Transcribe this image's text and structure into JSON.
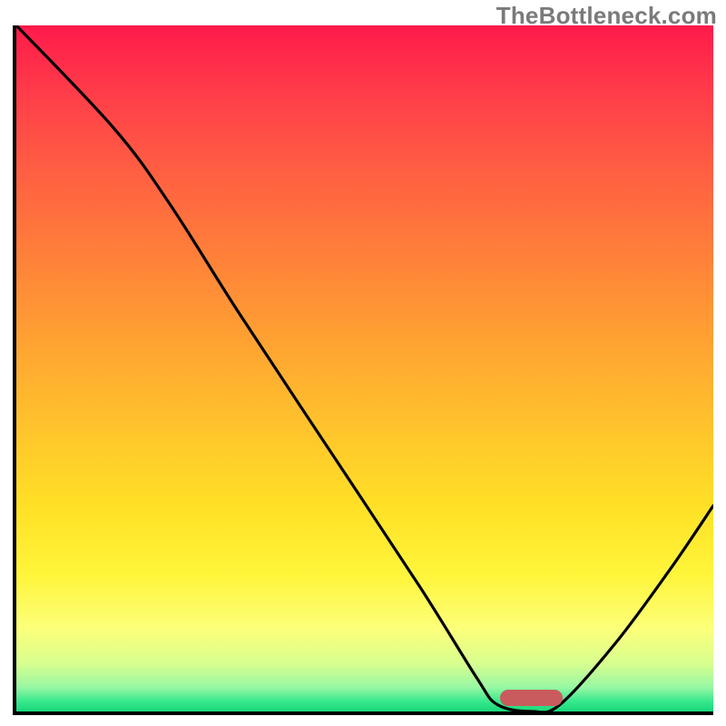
{
  "watermark": "TheBottleneck.com",
  "chart_data": {
    "type": "line",
    "title": "",
    "xlabel": "",
    "ylabel": "",
    "xlim": [
      0,
      100
    ],
    "ylim": [
      0,
      100
    ],
    "grid": false,
    "legend": false,
    "marker_x_range": [
      69,
      78
    ],
    "curve_points": [
      {
        "x": 0,
        "y": 100
      },
      {
        "x": 14,
        "y": 85
      },
      {
        "x": 22,
        "y": 74
      },
      {
        "x": 32,
        "y": 58
      },
      {
        "x": 45,
        "y": 38
      },
      {
        "x": 58,
        "y": 18
      },
      {
        "x": 66,
        "y": 5
      },
      {
        "x": 69,
        "y": 1
      },
      {
        "x": 74,
        "y": 0
      },
      {
        "x": 78,
        "y": 1
      },
      {
        "x": 86,
        "y": 10
      },
      {
        "x": 94,
        "y": 21
      },
      {
        "x": 100,
        "y": 30
      }
    ],
    "colors": {
      "top": "#ff1a4b",
      "bottom": "#18d879",
      "curve": "#000000",
      "marker": "#c95b5f"
    }
  }
}
